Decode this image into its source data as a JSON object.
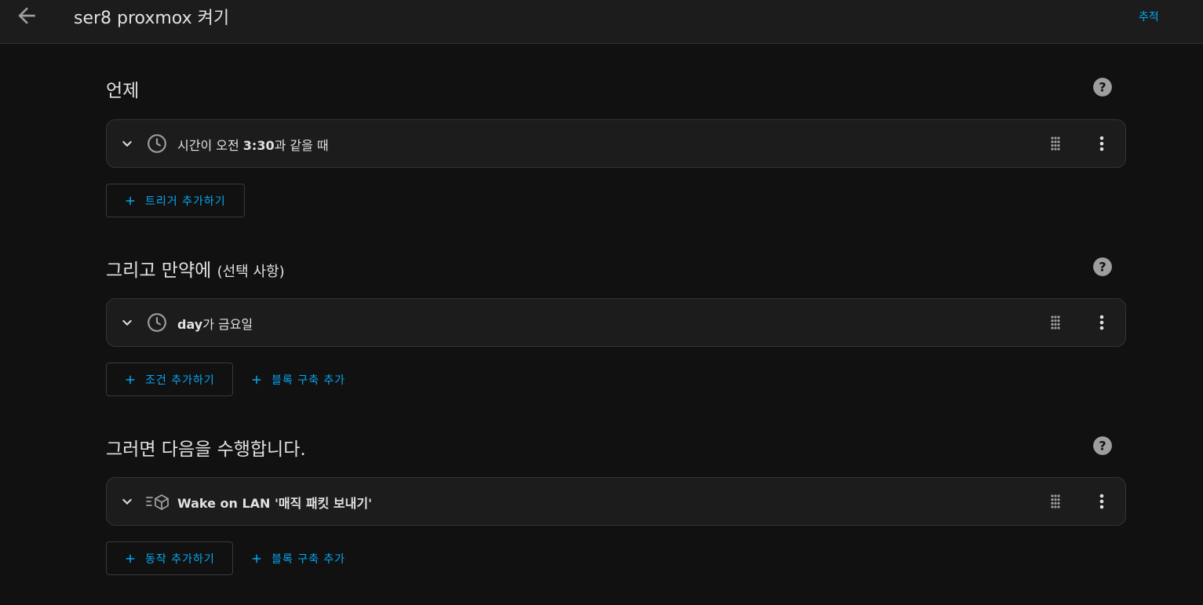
{
  "header": {
    "title": "ser8 proxmox 켜기",
    "trace_label": "추적",
    "back_icon": "arrow-left-icon"
  },
  "colors": {
    "background": "#111111",
    "card": "#1c1c1c",
    "accent": "#03a9f4",
    "icon": "#9e9e9e"
  },
  "triggers": {
    "title": "언제",
    "help_icon": "help-circle-icon",
    "items": [
      {
        "icon": "clock-icon",
        "prefix": "시간이 오전 ",
        "bold": "3:30",
        "suffix": "과 같을 때"
      }
    ],
    "add_label": "트리거 추가하기"
  },
  "conditions": {
    "title": "그리고 만약에",
    "title_optional": "(선택 사항)",
    "help_icon": "help-circle-icon",
    "items": [
      {
        "icon": "clock-icon",
        "bold": "day",
        "suffix": "가 금요일"
      }
    ],
    "add_label": "조건 추가하기",
    "building_block_label": "블록 구축 추가"
  },
  "actions": {
    "title": "그러면 다음을 수행합니다.",
    "help_icon": "help-circle-icon",
    "items": [
      {
        "icon": "service-cube-icon",
        "label": "Wake on LAN '매직 패킷 보내기'"
      }
    ],
    "add_label": "동작 추가하기",
    "building_block_label": "블록 구축 추가"
  }
}
